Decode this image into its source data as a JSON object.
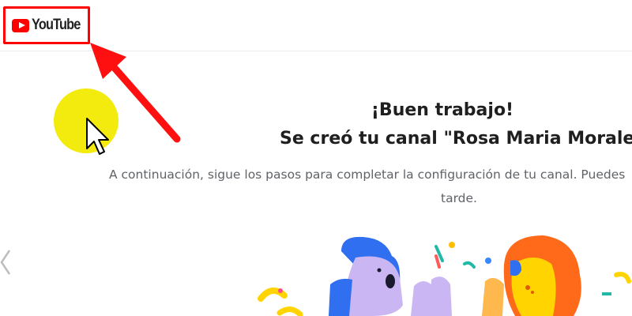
{
  "header": {
    "logo_text": "YouTube",
    "logo_icon": "play-icon"
  },
  "main": {
    "heading_line1": "¡Buen trabajo!",
    "heading_line2": "Se creó tu canal \"Rosa Maria Morales\"",
    "subtitle_line1": "A continuación, sigue los pasos para completar la configuración de tu canal. Puedes",
    "subtitle_line2": "tarde."
  },
  "annotation": {
    "highlight_color": "#ff0000",
    "cursor_highlight_color": "#f2ea00"
  },
  "nav": {
    "prev_icon": "chevron-left-icon"
  }
}
